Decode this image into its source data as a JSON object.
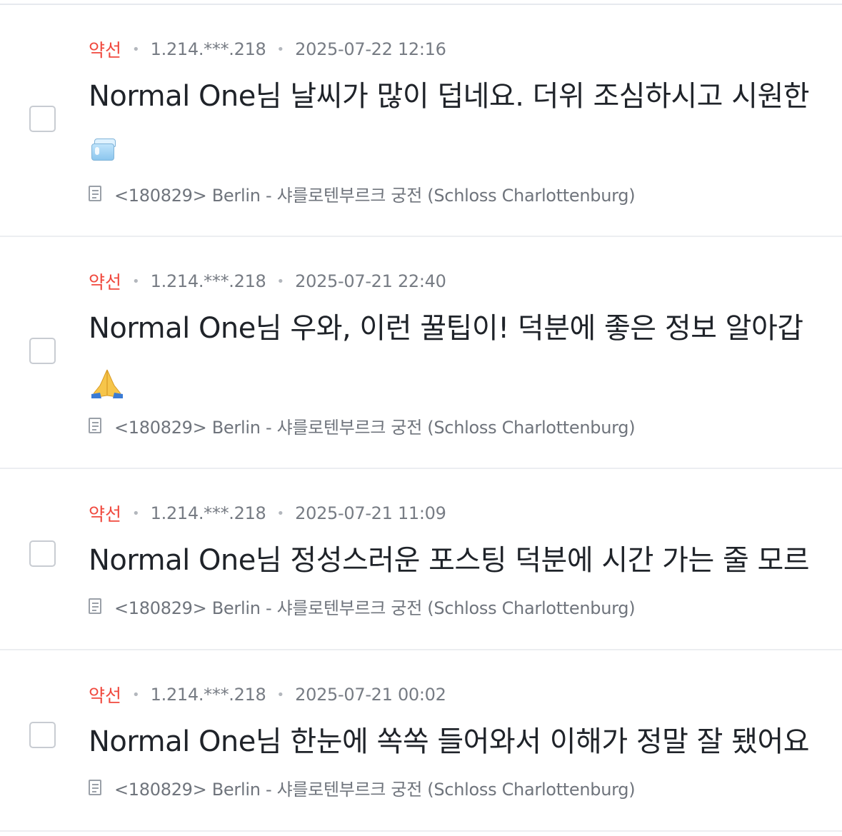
{
  "comments": [
    {
      "author": "약선",
      "ip": "1.214.***.218",
      "datetime": "2025-07-22 12:16",
      "text": "Normal One님 날씨가 많이 덥네요. 더위 조심하시고 시원한",
      "emoji": "ice-cube-icon",
      "post_title": "<180829> Berlin - 샤를로텐부르크 궁전 (Schloss Charlottenburg)"
    },
    {
      "author": "약선",
      "ip": "1.214.***.218",
      "datetime": "2025-07-21 22:40",
      "text": "Normal One님 우와, 이런 꿀팁이! 덕분에 좋은 정보 알아갑",
      "emoji": "folded-hands-icon",
      "post_title": "<180829> Berlin - 샤를로텐부르크 궁전 (Schloss Charlottenburg)"
    },
    {
      "author": "약선",
      "ip": "1.214.***.218",
      "datetime": "2025-07-21 11:09",
      "text": "Normal One님 정성스러운 포스팅 덕분에 시간 가는 줄 모르",
      "post_title": "<180829> Berlin - 샤를로텐부르크 궁전 (Schloss Charlottenburg)"
    },
    {
      "author": "약선",
      "ip": "1.214.***.218",
      "datetime": "2025-07-21 00:02",
      "text": "Normal One님 한눈에 쏙쏙 들어와서 이해가 정말 잘 됐어요",
      "post_title": "<180829> Berlin - 샤를로텐부르크 궁전 (Schloss Charlottenburg)"
    }
  ],
  "colors": {
    "author": "#f0493e",
    "meta": "#777c84",
    "comment_text": "#1f2329",
    "post_link": "#6f747c",
    "divider": "#eceef1"
  }
}
